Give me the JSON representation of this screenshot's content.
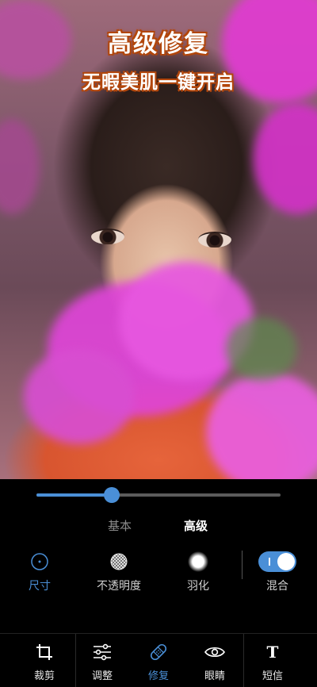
{
  "headline": {
    "title": "高级修复",
    "subtitle": "无暇美肌一键开启"
  },
  "slider": {
    "value": 0.31
  },
  "modes": {
    "basic": "基本",
    "advanced": "高级"
  },
  "tools": [
    {
      "id": "size",
      "label": "尺寸",
      "icon": "circle-dot-icon",
      "active": true
    },
    {
      "id": "opacity",
      "label": "不透明度",
      "icon": "checker-circle-icon",
      "active": false
    },
    {
      "id": "feather",
      "label": "羽化",
      "icon": "soft-circle-icon",
      "active": false
    },
    {
      "id": "blend",
      "label": "混合",
      "icon": "toggle-icon",
      "active": false,
      "toggle_on": true
    }
  ],
  "bottom_nav": [
    {
      "id": "crop",
      "label": "裁剪",
      "icon": "crop-icon"
    },
    {
      "id": "adjust",
      "label": "调整",
      "icon": "sliders-icon"
    },
    {
      "id": "repair",
      "label": "修复",
      "icon": "bandage-icon",
      "active": true
    },
    {
      "id": "eyes",
      "label": "眼睛",
      "icon": "eye-icon"
    },
    {
      "id": "text",
      "label": "短信",
      "icon": "text-icon"
    }
  ],
  "colors": {
    "accent": "#4a8fd7",
    "headline_outline": "#b3470c"
  }
}
